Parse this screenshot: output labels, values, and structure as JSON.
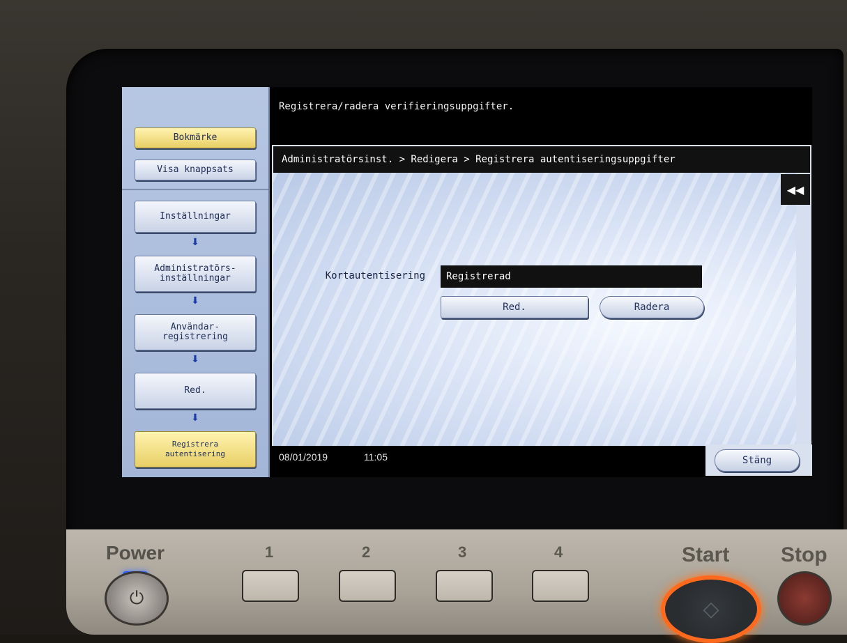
{
  "header": {
    "message": "Registrera/radera verifieringsuppgifter."
  },
  "sidebar": {
    "bookmark": "Bokmärke",
    "keypad": "Visa knappsats",
    "items": [
      {
        "label": "Inställningar"
      },
      {
        "label": "Administratörs-\ninställningar"
      },
      {
        "label": "Användar-\nregistrering"
      },
      {
        "label": "Red."
      },
      {
        "label": "Registrera\nautentisering"
      }
    ]
  },
  "breadcrumb": "Administratörsinst. > Redigera > Registrera autentiseringsuppgifter",
  "collapse_icon": "rewind-icon",
  "form": {
    "field_label": "Kortautentisering",
    "field_value": "Registrerad",
    "edit_label": "Red.",
    "delete_label": "Radera"
  },
  "footer": {
    "date": "08/01/2019",
    "time": "11:05",
    "close_label": "Stäng"
  },
  "hardware": {
    "power": "Power",
    "start": "Start",
    "stop": "Stop",
    "keys": [
      "1",
      "2",
      "3",
      "4"
    ]
  },
  "colors": {
    "accent_yellow": "#e8cf65",
    "start_ring": "#ff6a1f",
    "power_led": "#2f66ff"
  }
}
